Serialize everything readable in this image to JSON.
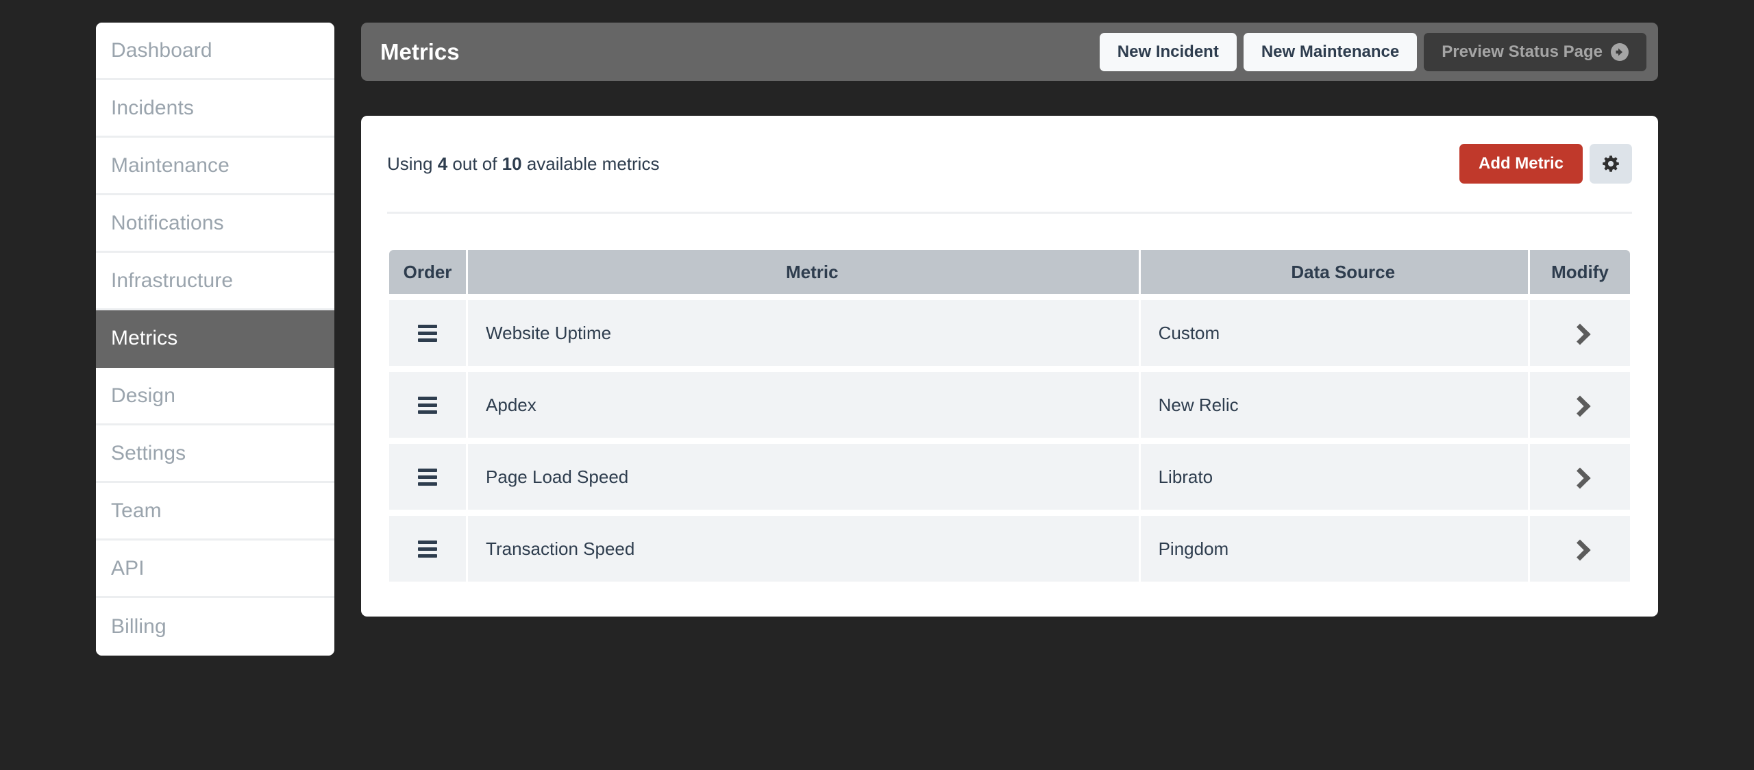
{
  "theme": {
    "page_background": "#242424",
    "accent_red": "#c0392b",
    "header_gray": "#666666",
    "table_header": "#bfc5cb",
    "row_background": "#f1f3f5",
    "text_navy": "#2e3d4e",
    "sidebar_muted": "#9aa4ad"
  },
  "sidebar": {
    "items": [
      {
        "label": "Dashboard",
        "active": false
      },
      {
        "label": "Incidents",
        "active": false
      },
      {
        "label": "Maintenance",
        "active": false
      },
      {
        "label": "Notifications",
        "active": false
      },
      {
        "label": "Infrastructure",
        "active": false
      },
      {
        "label": "Metrics",
        "active": true
      },
      {
        "label": "Design",
        "active": false
      },
      {
        "label": "Settings",
        "active": false
      },
      {
        "label": "Team",
        "active": false
      },
      {
        "label": "API",
        "active": false
      },
      {
        "label": "Billing",
        "active": false
      }
    ]
  },
  "topbar": {
    "title": "Metrics",
    "new_incident_label": "New Incident",
    "new_maintenance_label": "New Maintenance",
    "preview_label": "Preview Status Page",
    "preview_icon": "arrow-circle-right-icon"
  },
  "card": {
    "usage": {
      "prefix": "Using ",
      "used": "4",
      "middle": " out of ",
      "total": "10",
      "suffix": " available metrics"
    },
    "add_metric_label": "Add Metric",
    "settings_icon": "gear-icon"
  },
  "table": {
    "columns": [
      "Order",
      "Metric",
      "Data Source",
      "Modify"
    ],
    "rows": [
      {
        "order_icon": "drag-handle-icon",
        "metric": "Website Uptime",
        "data_source": "Custom",
        "modify_icon": "chevron-right-icon"
      },
      {
        "order_icon": "drag-handle-icon",
        "metric": "Apdex",
        "data_source": "New Relic",
        "modify_icon": "chevron-right-icon"
      },
      {
        "order_icon": "drag-handle-icon",
        "metric": "Page Load Speed",
        "data_source": "Librato",
        "modify_icon": "chevron-right-icon"
      },
      {
        "order_icon": "drag-handle-icon",
        "metric": "Transaction Speed",
        "data_source": "Pingdom",
        "modify_icon": "chevron-right-icon"
      }
    ]
  }
}
